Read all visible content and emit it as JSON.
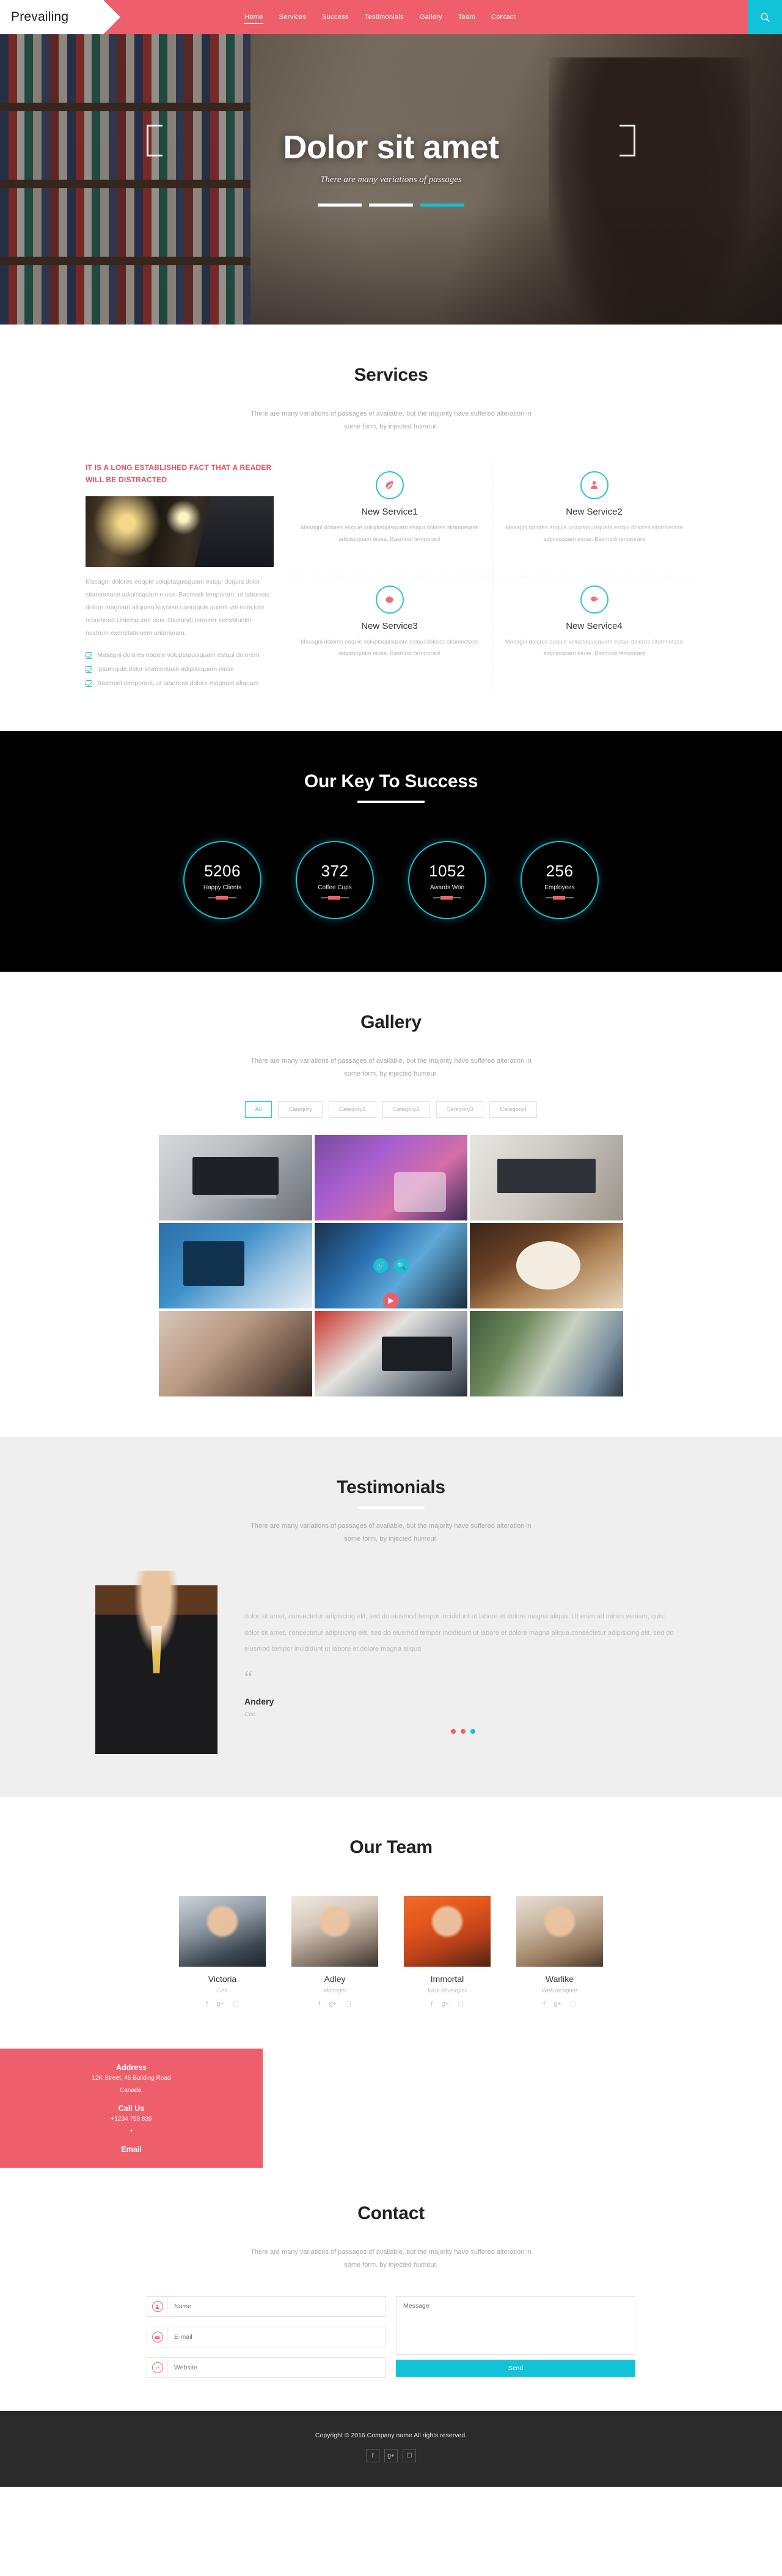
{
  "brand": "Prevailing",
  "nav": {
    "items": [
      {
        "label": "Home",
        "active": true
      },
      {
        "label": "Services",
        "active": false
      },
      {
        "label": "Success",
        "active": false
      },
      {
        "label": "Testimonials",
        "active": false
      },
      {
        "label": "Gallery",
        "active": false
      },
      {
        "label": "Team",
        "active": false
      },
      {
        "label": "Contact",
        "active": false
      }
    ],
    "search_icon": "search-icon"
  },
  "hero": {
    "title": "Dolor sit amet",
    "subtitle": "There are many variations of passages",
    "slides": 3,
    "active_slide": 3
  },
  "services": {
    "title": "Services",
    "subtitle": "There are many variations of passages of available, but the majority have suffered alteration in some form, by injected humour.",
    "left": {
      "heading": "IT IS A LONG ESTABLISHED FACT THAT A READER WILL BE DISTRACTED",
      "paragraph": "Masagni dolores eoquie voluptaquisquam estqui doquia dolor sitamnetase adipiscquam eiuse. Basmodi temporant, ut laboreas dolore magnam aliquam kuytase uaeraquis autem vel eum iure reprehend.Unicmquam eius. Basmodi temurer sehsMunim nostrum exercitationem untarseam.",
      "bullets": [
        "Masagni dolores eoquie voluptaquisquam estqui dolorem",
        "Ipsumquia dolor sitamnetase adipiscquam eiuse",
        "Basmodi temporant, ut laboreas dolore magnam aliquam"
      ]
    },
    "cards": [
      {
        "name": "New Service1",
        "icon": "leaf-icon",
        "desc": "Masagni dolores eoquie voluptaquisquam estqui dolores sitamnetase adipiscquam eiuse. Basmodi temporant"
      },
      {
        "name": "New Service2",
        "icon": "user-icon",
        "desc": "Masagni dolores eoquie voluptaquisquam estqui dolores sitamnetase adipiscquam eiuse. Basmodi temporant"
      },
      {
        "name": "New Service3",
        "icon": "gear-icon",
        "desc": "Masagni dolores eoquie voluptaquisquam estqui dolores sitamnetase adipiscquam eiuse. Basmodi temporant"
      },
      {
        "name": "New Service4",
        "icon": "piggy-bank-icon",
        "desc": "Masagni dolores eoquie voluptaquisquam estqui dolores sitamnetase adipiscquam eiuse. Basmodi temporant"
      }
    ]
  },
  "success": {
    "title": "Our Key To Success",
    "counters": [
      {
        "value": "5206",
        "label": "Happy Clients"
      },
      {
        "value": "372",
        "label": "Coffee Cups"
      },
      {
        "value": "1052",
        "label": "Awards Won"
      },
      {
        "value": "256",
        "label": "Employees"
      }
    ]
  },
  "gallery": {
    "title": "Gallery",
    "subtitle": "There are many variations of passages of available, but the majority have suffered alteration in some form, by injected humour.",
    "filters": [
      {
        "label": "All",
        "active": true
      },
      {
        "label": "Category",
        "active": false
      },
      {
        "label": "Category1",
        "active": false
      },
      {
        "label": "Category2",
        "active": false
      },
      {
        "label": "Category3",
        "active": false
      },
      {
        "label": "Category4",
        "active": false
      }
    ],
    "tiles": 9,
    "hover_icons": [
      "link-icon",
      "zoom-icon"
    ],
    "play_icon": "play-icon"
  },
  "testimonials": {
    "title": "Testimonials",
    "subtitle": "There are many variations of passages of available, but the majority have suffered alteration in some form, by injected humour.",
    "quote": "dolor sit amet, consectetur adipiscing elit, sed do eiusmod tempor incididunt ut labore et dolore magna aliqua. Ut enim ad minim veniam, quis: dolor sit amet, consectetur adipisicing elit, sed do eiusmod tempor incididunt ut labore et dolore magna aliqua.consectetur adipisicing elit, sed do eiusmod tempor incididunt ut labore et dolore magna aliqua",
    "quote_mark": "“",
    "author": "Andery",
    "role": "Ceo",
    "dots": 3,
    "active_dot": 3
  },
  "team": {
    "title": "Our Team",
    "members": [
      {
        "name": "Victoria",
        "role": "Ceo",
        "social": [
          "f",
          "g+",
          "ig"
        ]
      },
      {
        "name": "Adley",
        "role": "Manager",
        "social": [
          "f",
          "g+",
          "ig"
        ]
      },
      {
        "name": "Immortal",
        "role": "Web developer",
        "social": [
          "f",
          "g+",
          "ig"
        ]
      },
      {
        "name": "Warlike",
        "role": "Web designer",
        "social": [
          "f",
          "g+",
          "ig"
        ]
      }
    ]
  },
  "address": {
    "address_title": "Address",
    "address_line1": "12K Street, 45 Building Road",
    "address_line2": "Canada.",
    "call_title": "Call Us",
    "call_line1": "+1234 758 839",
    "call_line2": "+",
    "email_title": "Email"
  },
  "contact": {
    "title": "Contact",
    "subtitle": "There are many variations of passages of available, but the majority have suffered alteration in some form, by injected humour.",
    "name_placeholder": "Name",
    "email_placeholder": "E-mail",
    "website_placeholder": "Website",
    "message_placeholder": "Message",
    "send_label": "Send",
    "name_icon": "user-icon",
    "email_icon": "envelope-icon",
    "website_icon": "link-icon"
  },
  "footer": {
    "copyright": "Copyright © 2016.Company name All rights reserved.",
    "social": [
      "f",
      "g+",
      "ig"
    ]
  },
  "colors": {
    "accent_pink": "#ef5f6b",
    "accent_cyan": "#12c2d8",
    "teal": "#2ec6c6",
    "dark": "#000000",
    "footer": "#2b2b2b"
  }
}
